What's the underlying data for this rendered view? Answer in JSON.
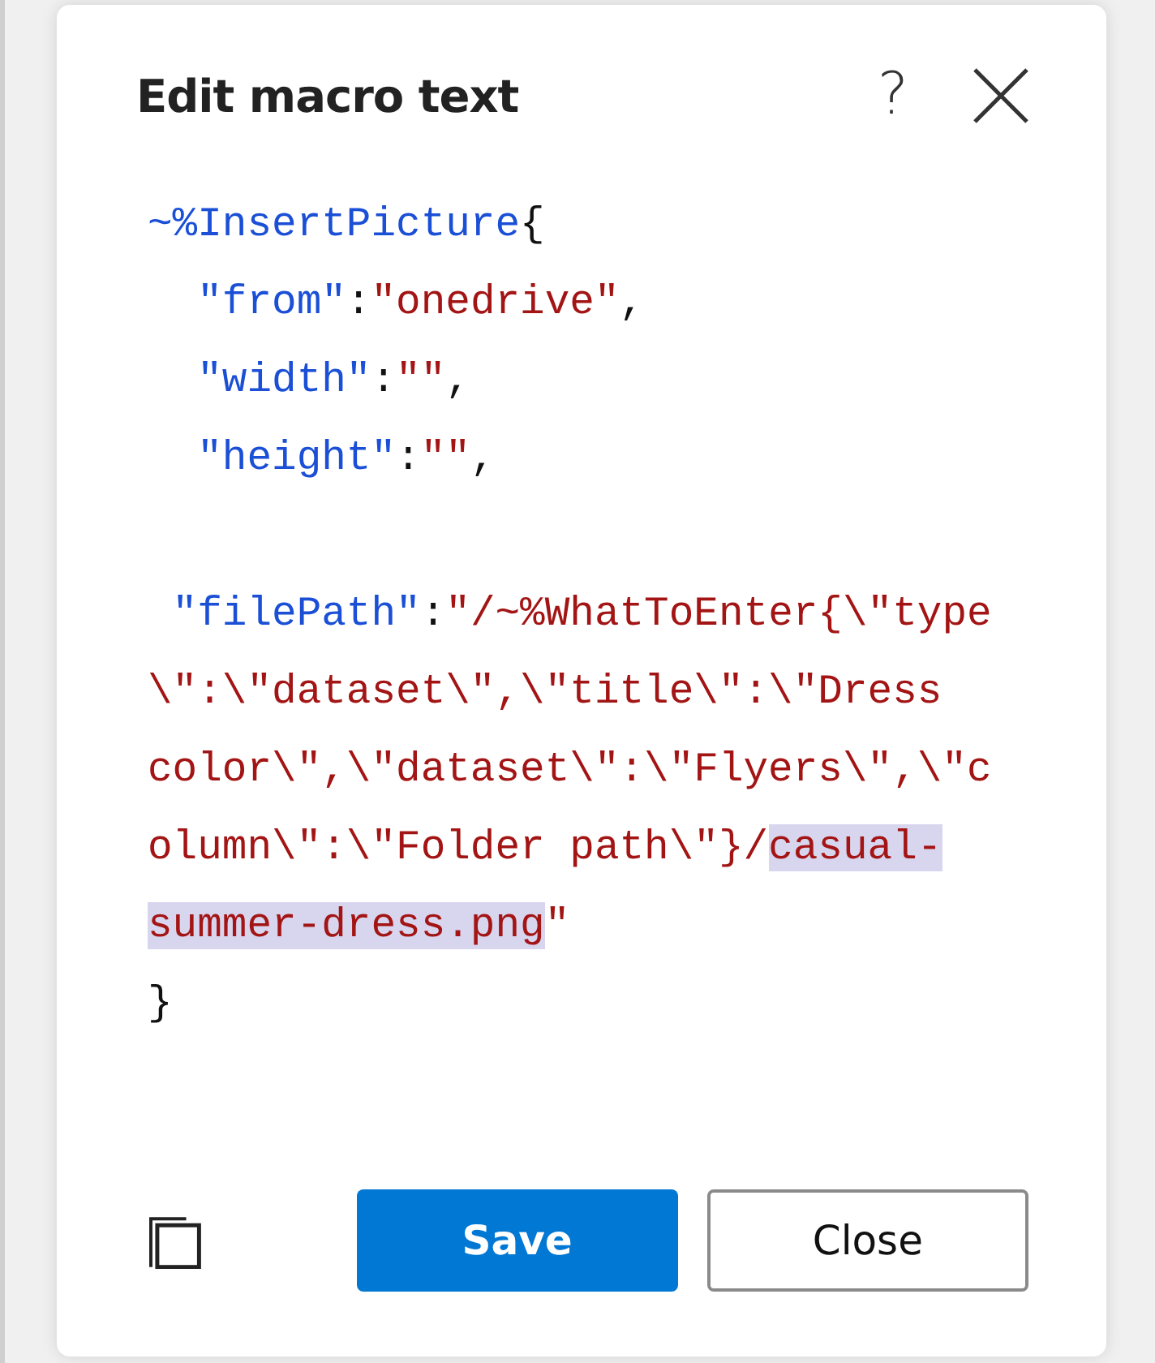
{
  "dialog": {
    "title": "Edit macro text",
    "help": "?"
  },
  "code_blocks": [
    {
      "lines": [
        {
          "segments": [
            {
              "kind": "macro",
              "text": "~%InsertPicture",
              "selected": false
            },
            {
              "kind": "punct",
              "text": "{",
              "selected": false
            }
          ]
        },
        {
          "segments": [
            {
              "kind": "key",
              "text": "  \"from\"",
              "selected": false
            },
            {
              "kind": "punct",
              "text": ":",
              "selected": false
            },
            {
              "kind": "string",
              "text": "\"onedrive\"",
              "selected": false
            },
            {
              "kind": "punct",
              "text": ",",
              "selected": false
            }
          ]
        },
        {
          "segments": [
            {
              "kind": "key",
              "text": "  \"width\"",
              "selected": false
            },
            {
              "kind": "punct",
              "text": ":",
              "selected": false
            },
            {
              "kind": "string",
              "text": "\"\"",
              "selected": false
            },
            {
              "kind": "punct",
              "text": ",",
              "selected": false
            }
          ]
        },
        {
          "segments": [
            {
              "kind": "key",
              "text": "  \"height\"",
              "selected": false
            },
            {
              "kind": "punct",
              "text": ":",
              "selected": false
            },
            {
              "kind": "string",
              "text": "\"\"",
              "selected": false
            },
            {
              "kind": "punct",
              "text": ",",
              "selected": false
            }
          ]
        }
      ]
    },
    {
      "lines": [
        {
          "segments": [
            {
              "kind": "key",
              "text": " \"filePath\"",
              "selected": false
            },
            {
              "kind": "punct",
              "text": ":",
              "selected": false
            },
            {
              "kind": "string",
              "text": "\"/~%WhatToEnter{\\\"type",
              "selected": false
            }
          ]
        },
        {
          "segments": [
            {
              "kind": "string",
              "text": "\\\":\\\"dataset\\\",\\\"title\\\":\\\"Dress",
              "selected": false
            }
          ]
        },
        {
          "segments": [
            {
              "kind": "string",
              "text": "color\\\",\\\"dataset\\\":\\\"Flyers\\\",\\\"c",
              "selected": false
            }
          ]
        },
        {
          "segments": [
            {
              "kind": "string",
              "text": "olumn\\\":\\\"Folder path\\\"}/",
              "selected": false
            },
            {
              "kind": "string",
              "text": "casual-",
              "selected": true
            }
          ]
        },
        {
          "segments": [
            {
              "kind": "string",
              "text": "summer-dress.png",
              "selected": true
            },
            {
              "kind": "string",
              "text": "\"",
              "selected": false
            }
          ]
        },
        {
          "segments": [
            {
              "kind": "punct",
              "text": "}",
              "selected": false
            }
          ]
        }
      ]
    }
  ],
  "buttons": [
    {
      "label": "Save",
      "kind": "primary"
    },
    {
      "label": "Close",
      "kind": "secondary"
    }
  ]
}
